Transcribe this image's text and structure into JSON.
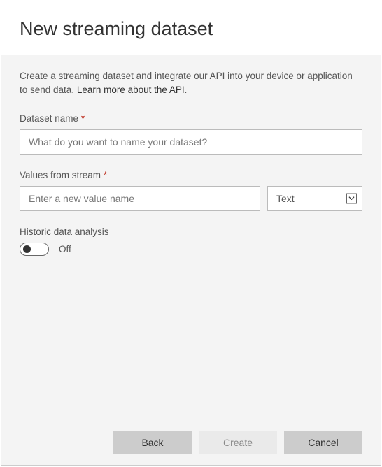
{
  "header": {
    "title": "New streaming dataset"
  },
  "description": {
    "text_before": "Create a streaming dataset and integrate our API into your device or application to send data. ",
    "link_text": "Learn more about the API",
    "text_after": "."
  },
  "datasetName": {
    "label": "Dataset name",
    "required_marker": "*",
    "placeholder": "What do you want to name your dataset?",
    "value": ""
  },
  "valuesFromStream": {
    "label": "Values from stream",
    "required_marker": "*",
    "name_placeholder": "Enter a new value name",
    "name_value": "",
    "type_selected": "Text"
  },
  "historicData": {
    "label": "Historic data analysis",
    "state_label": "Off",
    "enabled": false
  },
  "footer": {
    "back": "Back",
    "create": "Create",
    "cancel": "Cancel"
  }
}
